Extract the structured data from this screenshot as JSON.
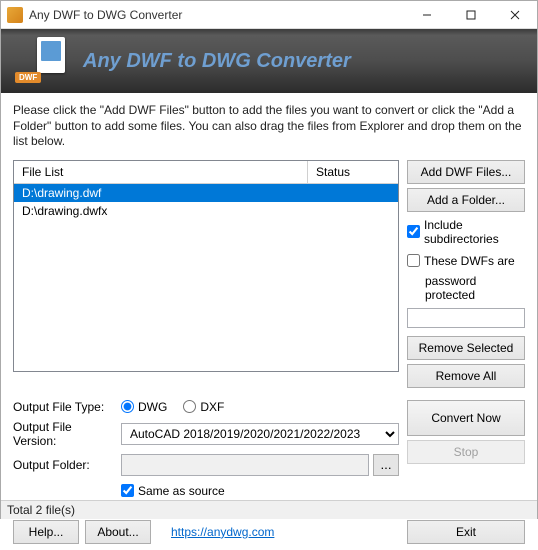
{
  "titlebar": {
    "title": "Any DWF to DWG Converter"
  },
  "banner": {
    "heading": "Any DWF to DWG Converter",
    "logo_tag": "DWF"
  },
  "instructions": "Please click the \"Add DWF Files\" button to add the files you want to convert or click the \"Add a Folder\" button to add some files. You can also drag the files from Explorer and drop them on the list below.",
  "file_list": {
    "header_file": "File List",
    "header_status": "Status",
    "rows": [
      {
        "path": "D:\\drawing.dwf",
        "status": "",
        "selected": true
      },
      {
        "path": "D:\\drawing.dwfx",
        "status": "",
        "selected": false
      }
    ]
  },
  "side": {
    "add_files": "Add DWF Files...",
    "add_folder": "Add a Folder...",
    "include_sub": "Include subdirectories",
    "include_sub_checked": true,
    "pwd_label1": "These DWFs are",
    "pwd_label2": "password protected",
    "pwd_checked": false,
    "pwd_value": "",
    "remove_selected": "Remove Selected",
    "remove_all": "Remove All"
  },
  "output": {
    "type_label": "Output File Type:",
    "radio_dwg": "DWG",
    "radio_dxf": "DXF",
    "type_selected": "DWG",
    "version_label": "Output File Version:",
    "version_value": "AutoCAD 2018/2019/2020/2021/2022/2023",
    "folder_label": "Output Folder:",
    "folder_value": "",
    "same_as_source": "Same as source",
    "same_checked": true,
    "browse_label": "..."
  },
  "actions": {
    "convert": "Convert Now",
    "stop": "Stop",
    "help": "Help...",
    "about": "About...",
    "link": "https://anydwg.com",
    "exit": "Exit"
  },
  "status": "Total 2 file(s)"
}
